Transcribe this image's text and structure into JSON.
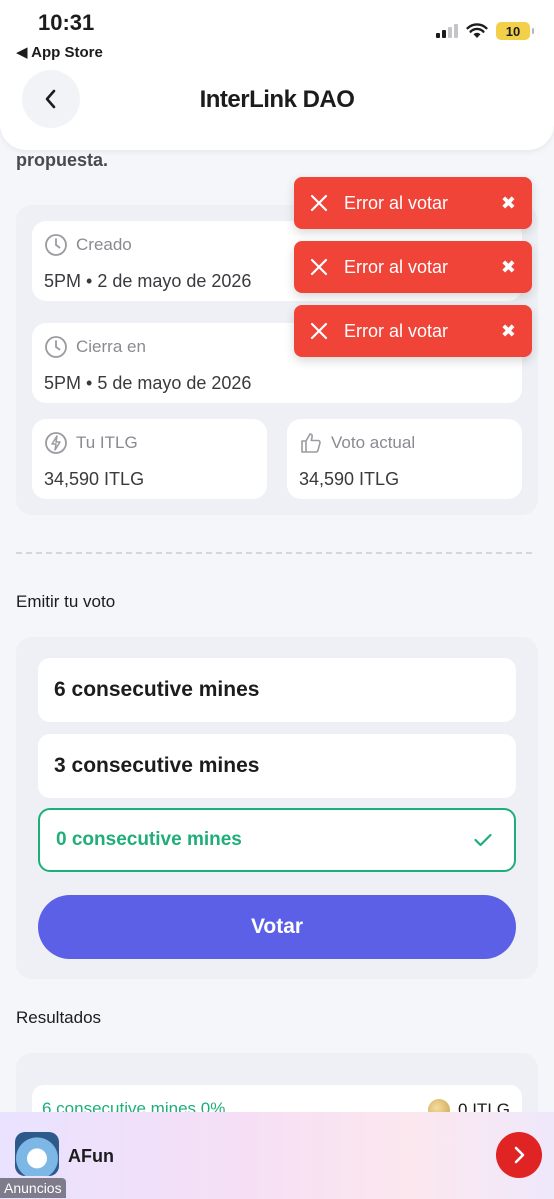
{
  "status_bar": {
    "time": "10:31",
    "back_app": "◀ App Store",
    "battery": "10"
  },
  "header": {
    "title": "InterLink DAO"
  },
  "proposal": {
    "partial_text": "propuesta."
  },
  "info": {
    "created": {
      "label": "Creado",
      "value": "5PM • 2 de mayo de 2026"
    },
    "closes": {
      "label": "Cierra en",
      "value": "5PM • 5 de mayo de 2026"
    },
    "balance": {
      "label": "Tu ITLG",
      "value": "34,590 ITLG"
    },
    "current_vote": {
      "label": "Voto actual",
      "value": "34,590 ITLG"
    }
  },
  "vote": {
    "section_label": "Emitir tu voto",
    "options": [
      {
        "label": "6 consecutive mines",
        "selected": false
      },
      {
        "label": "3 consecutive mines",
        "selected": false
      },
      {
        "label": "0 consecutive mines",
        "selected": true
      }
    ],
    "button_label": "Votar"
  },
  "results": {
    "section_label": "Resultados",
    "rows": [
      {
        "label": "6 consecutive mines 0%",
        "value": "0 ITLG"
      }
    ]
  },
  "toasts": [
    {
      "text": "Error al votar"
    },
    {
      "text": "Error al votar"
    },
    {
      "text": "Error al votar"
    }
  ],
  "ad": {
    "app_name": "AFun",
    "tag": "Anuncios"
  },
  "colors": {
    "accent": "#5b60e6",
    "success": "#1fae7a",
    "error": "#f04438",
    "ad_button": "#e02323"
  }
}
